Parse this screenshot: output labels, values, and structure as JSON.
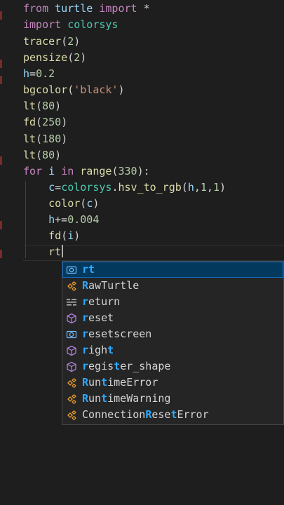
{
  "editor": {
    "lines": [
      [
        {
          "t": "from",
          "c": "kw"
        },
        {
          "t": " turtle ",
          "c": "var"
        },
        {
          "t": "import",
          "c": "kw"
        },
        {
          "t": " *",
          "c": "op"
        }
      ],
      [
        {
          "t": "import",
          "c": "kw"
        },
        {
          "t": " colorsys",
          "c": "mod"
        }
      ],
      [
        {
          "t": "tracer",
          "c": "fn"
        },
        {
          "t": "(",
          "c": "op"
        },
        {
          "t": "2",
          "c": "num"
        },
        {
          "t": ")",
          "c": "op"
        }
      ],
      [
        {
          "t": "pensize",
          "c": "fn"
        },
        {
          "t": "(",
          "c": "op"
        },
        {
          "t": "2",
          "c": "num"
        },
        {
          "t": ")",
          "c": "op"
        }
      ],
      [
        {
          "t": "h",
          "c": "var"
        },
        {
          "t": "=",
          "c": "op"
        },
        {
          "t": "0.2",
          "c": "num"
        }
      ],
      [
        {
          "t": "bgcolor",
          "c": "fn"
        },
        {
          "t": "(",
          "c": "op"
        },
        {
          "t": "'black'",
          "c": "str"
        },
        {
          "t": ")",
          "c": "op"
        }
      ],
      [
        {
          "t": "lt",
          "c": "fn"
        },
        {
          "t": "(",
          "c": "op"
        },
        {
          "t": "80",
          "c": "num"
        },
        {
          "t": ")",
          "c": "op"
        }
      ],
      [
        {
          "t": "fd",
          "c": "fn"
        },
        {
          "t": "(",
          "c": "op"
        },
        {
          "t": "250",
          "c": "num"
        },
        {
          "t": ")",
          "c": "op"
        }
      ],
      [
        {
          "t": "lt",
          "c": "fn"
        },
        {
          "t": "(",
          "c": "op"
        },
        {
          "t": "180",
          "c": "num"
        },
        {
          "t": ")",
          "c": "op"
        }
      ],
      [
        {
          "t": "lt",
          "c": "fn"
        },
        {
          "t": "(",
          "c": "op"
        },
        {
          "t": "80",
          "c": "num"
        },
        {
          "t": ")",
          "c": "op"
        }
      ],
      [
        {
          "t": "for",
          "c": "kw"
        },
        {
          "t": " i ",
          "c": "var"
        },
        {
          "t": "in",
          "c": "kw"
        },
        {
          "t": " ",
          "c": "op"
        },
        {
          "t": "range",
          "c": "fn"
        },
        {
          "t": "(",
          "c": "op"
        },
        {
          "t": "330",
          "c": "num"
        },
        {
          "t": "):",
          "c": "op"
        }
      ],
      [
        {
          "t": "    ",
          "c": "op"
        },
        {
          "t": "c",
          "c": "var"
        },
        {
          "t": "=",
          "c": "op"
        },
        {
          "t": "colorsys",
          "c": "mod"
        },
        {
          "t": ".",
          "c": "op"
        },
        {
          "t": "hsv_to_rgb",
          "c": "fn"
        },
        {
          "t": "(",
          "c": "op"
        },
        {
          "t": "h",
          "c": "var"
        },
        {
          "t": ",",
          "c": "op"
        },
        {
          "t": "1",
          "c": "num"
        },
        {
          "t": ",",
          "c": "op"
        },
        {
          "t": "1",
          "c": "num"
        },
        {
          "t": ")",
          "c": "op"
        }
      ],
      [
        {
          "t": "    ",
          "c": "op"
        },
        {
          "t": "color",
          "c": "fn"
        },
        {
          "t": "(",
          "c": "op"
        },
        {
          "t": "c",
          "c": "var"
        },
        {
          "t": ")",
          "c": "op"
        }
      ],
      [
        {
          "t": "    ",
          "c": "op"
        },
        {
          "t": "h",
          "c": "var"
        },
        {
          "t": "+=",
          "c": "op"
        },
        {
          "t": "0.004",
          "c": "num"
        }
      ],
      [
        {
          "t": "    ",
          "c": "op"
        },
        {
          "t": "fd",
          "c": "fn"
        },
        {
          "t": "(",
          "c": "op"
        },
        {
          "t": "i",
          "c": "var"
        },
        {
          "t": ")",
          "c": "op"
        }
      ],
      [
        {
          "t": "    ",
          "c": "op"
        },
        {
          "t": "rt",
          "c": "fn"
        }
      ]
    ]
  },
  "suggestions": [
    {
      "pre": "",
      "match": "rt",
      "post": "",
      "icon": "variable-icon",
      "selected": true
    },
    {
      "pre": "",
      "match": "R",
      "post": "awTurtle",
      "icon": "class-icon",
      "selected": false
    },
    {
      "pre": "",
      "match": "r",
      "post": "eturn",
      "icon": "keyword-icon",
      "selected": false
    },
    {
      "pre": "",
      "match": "r",
      "post": "eset",
      "icon": "method-icon",
      "selected": false
    },
    {
      "pre": "",
      "match": "r",
      "post": "esetscreen",
      "icon": "variable-icon",
      "selected": false
    },
    {
      "pre": "",
      "match": "r",
      "post": "igh",
      "icon": "method-icon",
      "selected": false,
      "tail": "t",
      "tailMatch": true
    },
    {
      "pre": "",
      "match": "r",
      "post": "egis",
      "icon": "method-icon",
      "selected": false,
      "tail": "t",
      "tailMatch": true,
      "rest": "er_shape"
    },
    {
      "pre": "",
      "match": "R",
      "post": "un",
      "icon": "class-icon",
      "selected": false,
      "tail": "t",
      "tailMatch": true,
      "rest": "imeError"
    },
    {
      "pre": "",
      "match": "R",
      "post": "un",
      "icon": "class-icon",
      "selected": false,
      "tail": "t",
      "tailMatch": true,
      "rest": "imeWarning"
    },
    {
      "pre": "Connection",
      "match": "R",
      "post": "ese",
      "icon": "class-icon",
      "selected": false,
      "tail": "t",
      "tailMatch": true,
      "rest": "Error"
    }
  ],
  "colors": {
    "background": "#1e1e1e",
    "keyword": "#c586c0",
    "function": "#dcdcaa",
    "variable": "#9cdcfe",
    "number": "#b5cea8",
    "string": "#ce9178",
    "highlight": "#2aaaff",
    "suggest_bg": "#252526",
    "selected_bg": "#04395e"
  }
}
